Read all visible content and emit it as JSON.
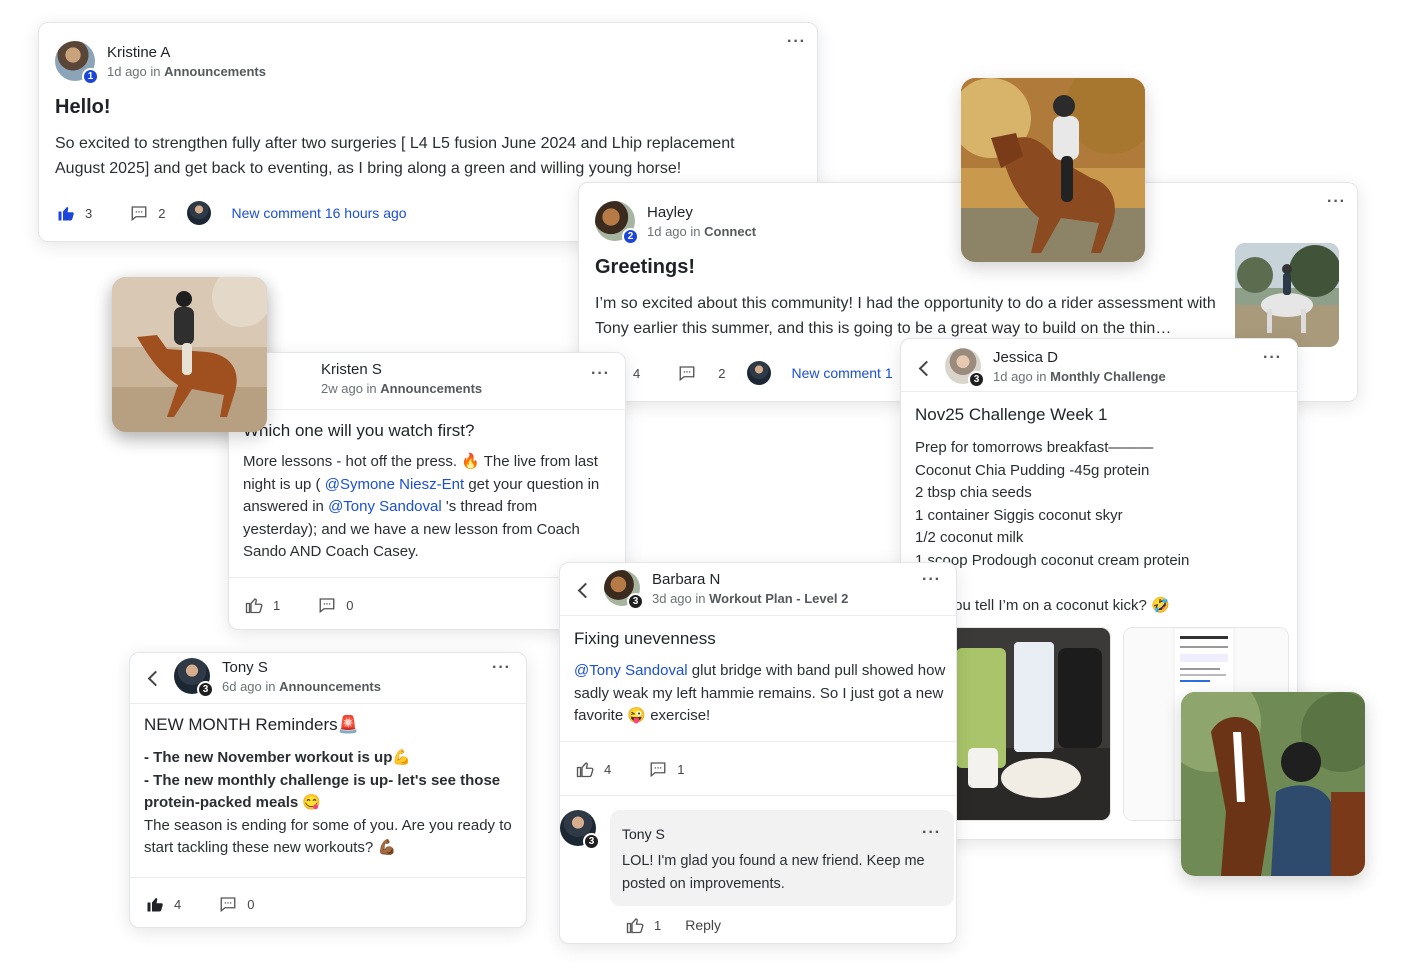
{
  "posts": {
    "kristine": {
      "author": "Kristine A",
      "badge": "1",
      "time": "1d ago in",
      "space": "Announcements",
      "title": "Hello!",
      "body": "So excited to strengthen fully after two surgeries [ L4 L5 fusion June 2024 and Lhip replacement August 2025] and get back to eventing, as I bring along a green and willing young horse!",
      "likes": "3",
      "comments": "2",
      "new_comment": "New comment 16 hours ago"
    },
    "hayley": {
      "author": "Hayley",
      "badge": "2",
      "time": "1d ago in",
      "space": "Connect",
      "title": "Greetings!",
      "body": "I’m so excited about this community! I had the opportunity to do a rider assessment with Tony earlier this summer, and this is going to be a great way to build on the thin…",
      "likes": "4",
      "comments": "2",
      "new_comment": "New comment 1"
    },
    "kristen": {
      "author": "Kristen S",
      "time": "2w ago in",
      "space": "Announcements",
      "title": "Which one will you watch first?",
      "body_1": "More lessons - hot off the press. 🔥 The live from last night is up ( ",
      "mention_1": "@Symone Niesz-Ent",
      "body_2": " get your question in answered in ",
      "mention_2": "@Tony Sandoval",
      "body_3": " 's thread from yesterday); and we have a new lesson from Coach Sando AND Coach Casey.",
      "likes": "1",
      "comments": "0"
    },
    "jessica": {
      "author": "Jessica D",
      "badge": "3",
      "time": "1d ago in",
      "space": "Monthly Challenge",
      "title": "Nov25 Challenge Week 1",
      "lines": [
        "Prep for tomorrows breakfast———",
        "Coconut Chia Pudding -45g protein",
        "2 tbsp chia seeds",
        "1 container Siggis coconut skyr",
        "1/2 coconut milk",
        "1 scoop Prodough coconut cream protein",
        "",
        "Can you tell I’m on a coconut kick? 🤣"
      ]
    },
    "barbara": {
      "author": "Barbara N",
      "badge": "3",
      "time": "3d ago in",
      "space": "Workout Plan - Level 2",
      "title": "Fixing unevenness",
      "mention": "@Tony Sandoval",
      "body": " glut bridge with band pull showed how sadly weak my left hammie remains. So I just got a new favorite 😜 exercise!",
      "likes": "4",
      "comments": "1",
      "reply": {
        "author": "Tony S",
        "badge": "3",
        "body": "LOL! I'm glad you found a new friend. Keep me posted on improvements.",
        "likes": "1",
        "reply_label": "Reply"
      }
    },
    "tony": {
      "author": "Tony S",
      "badge": "3",
      "time": "6d ago in",
      "space": "Announcements",
      "title": "NEW MONTH Reminders🚨",
      "bold_1": "- The new November workout is up💪",
      "bold_2": "- The new monthly challenge is up- let's see those protein-packed meals 😋",
      "body": "The season is ending for some of you. Are you ready to start tackling these new workouts? 💪🏾",
      "likes": "4",
      "comments": "0"
    }
  },
  "icons": {
    "like": "thumbs-up-icon",
    "comment": "comment-icon",
    "more": "more-options-icon",
    "back": "chevron-left-icon"
  },
  "colors": {
    "accent": "#1b4fd8",
    "badge_blue": "#1b46d9"
  }
}
